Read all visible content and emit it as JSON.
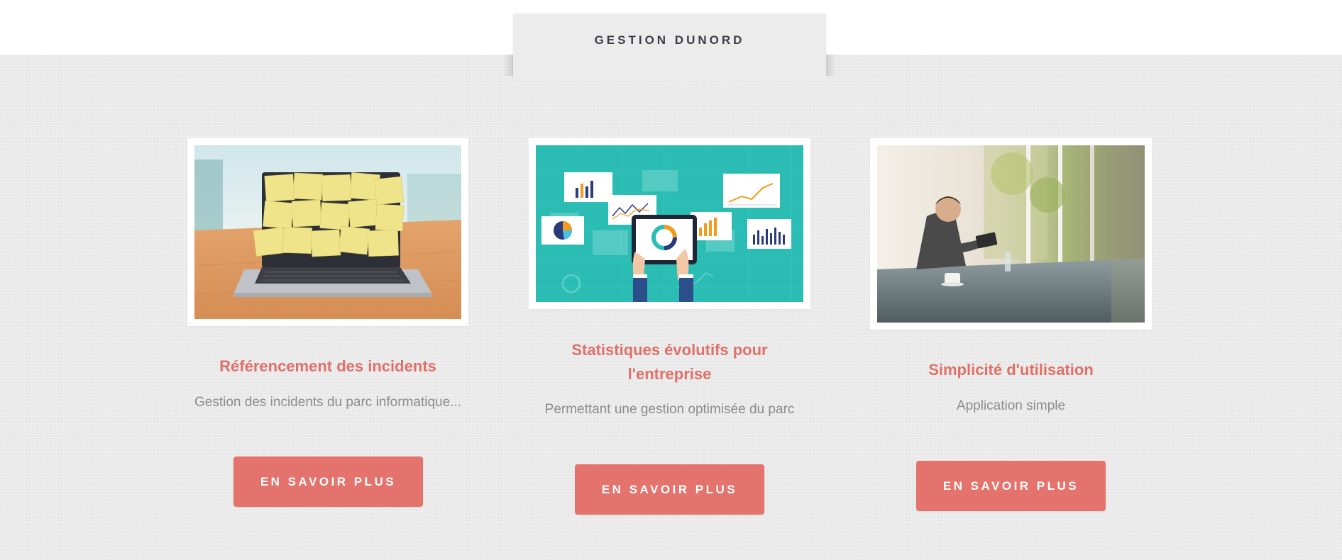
{
  "header": {
    "brand": "GESTION DUNORD"
  },
  "features": [
    {
      "image": "laptop-covered-in-sticky-notes",
      "title": "Référencement des incidents",
      "description": "Gestion des incidents du parc informatique...",
      "button": "EN SAVOIR PLUS"
    },
    {
      "image": "analytics-dashboard-illustration",
      "title_line1": "Statistiques évolutifs pour",
      "title_line2": "l'entreprise",
      "description": "Permettant une gestion optimisée du parc",
      "button": "EN SAVOIR PLUS"
    },
    {
      "image": "man-using-tablet-at-table",
      "title": "Simplicité d'utilisation",
      "description": "Application simple",
      "button": "EN SAVOIR PLUS"
    }
  ],
  "colors": {
    "accent": "#e5736d",
    "title": "#e07068",
    "description": "#8c8c8c",
    "brand_text": "#3d3d46",
    "background": "#ebebeb",
    "teal": "#2bbcb4"
  }
}
